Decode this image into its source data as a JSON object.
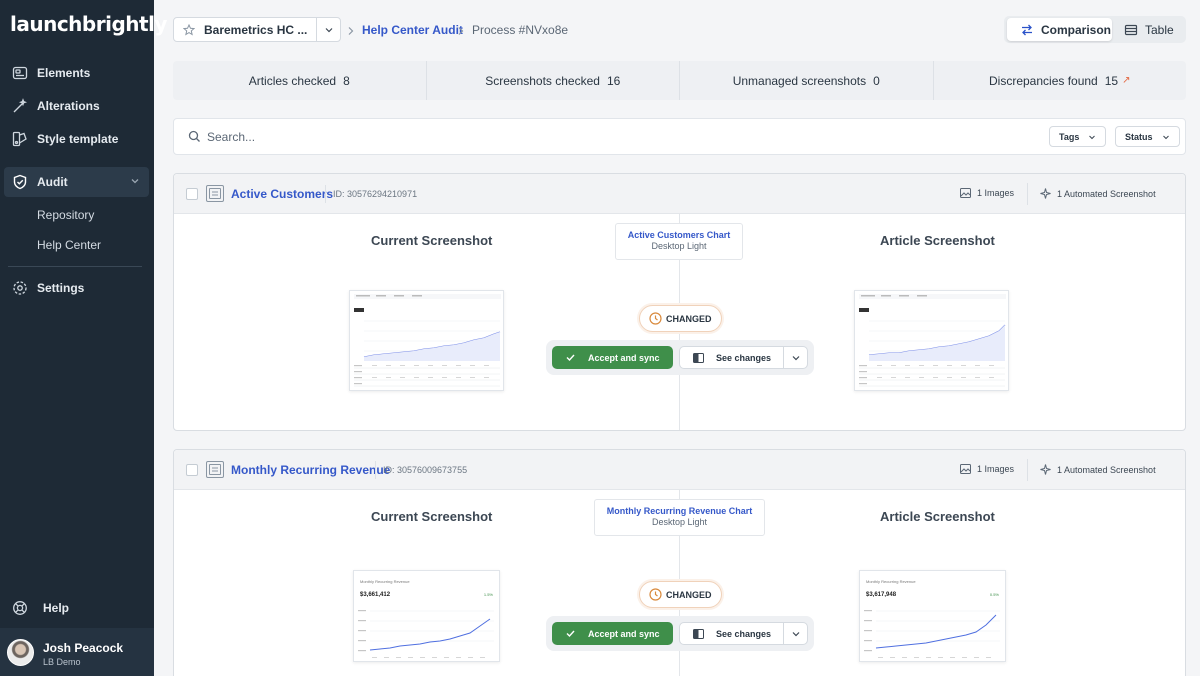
{
  "app": {
    "logo": "launchbrightly"
  },
  "sidebar": {
    "items": [
      {
        "label": "Elements",
        "icon": "elements-icon"
      },
      {
        "label": "Alterations",
        "icon": "wand-icon"
      },
      {
        "label": "Style template",
        "icon": "style-template-icon"
      },
      {
        "label": "Audit",
        "icon": "shield-check-icon"
      }
    ],
    "subitems": [
      {
        "label": "Repository"
      },
      {
        "label": "Help Center"
      }
    ],
    "settings": {
      "label": "Settings",
      "icon": "gear-icon"
    },
    "help": {
      "label": "Help",
      "icon": "help-icon"
    },
    "user": {
      "name": "Josh Peacock",
      "org": "LB Demo"
    }
  },
  "header": {
    "project": "Baremetrics HC ...",
    "breadcrumb_link": "Help Center Audit",
    "breadcrumb_current": "Process #NVxo8e",
    "view": {
      "comparison": "Comparison",
      "table": "Table",
      "active": "Comparison"
    }
  },
  "stats": [
    {
      "label": "Articles checked",
      "value": "8"
    },
    {
      "label": "Screenshots checked",
      "value": "16"
    },
    {
      "label": "Unmanaged screenshots",
      "value": "0"
    },
    {
      "label": "Discrepancies found",
      "value": "15",
      "arrow": "↗"
    }
  ],
  "search": {
    "placeholder": "Search...",
    "value": ""
  },
  "filters": {
    "tags": "Tags",
    "status": "Status"
  },
  "cards": [
    {
      "title": "Active Customers",
      "id": "ID: 30576294210971",
      "images": "1 Images",
      "automated": "1 Automated Screenshot",
      "current_label": "Current Screenshot",
      "article_label": "Article Screenshot",
      "chart_name": "Active Customers Chart",
      "chart_variant": "Desktop Light",
      "status": "CHANGED",
      "accept": "Accept and sync",
      "see_changes": "See changes"
    },
    {
      "title": "Monthly Recurring Revenue",
      "id": "ID: 30576009673755",
      "images": "1 Images",
      "automated": "1 Automated Screenshot",
      "current_label": "Current Screenshot",
      "article_label": "Article Screenshot",
      "chart_name": "Monthly Recurring Revenue Chart",
      "chart_variant": "Desktop Light",
      "status": "CHANGED",
      "accept": "Accept and sync",
      "see_changes": "See changes",
      "current_thumb": {
        "title": "Monthly Recurring Revenue",
        "value": "$3,661,412",
        "badge": "1.5%"
      },
      "article_thumb": {
        "title": "Monthly Recurring Revenue",
        "value": "$3,617,948",
        "badge": "0.5%"
      }
    }
  ],
  "colors": {
    "sidebar": "#1e2a36",
    "link": "#3558c9",
    "accept": "#3f8f4a",
    "changed_border": "#f0d2ba"
  }
}
